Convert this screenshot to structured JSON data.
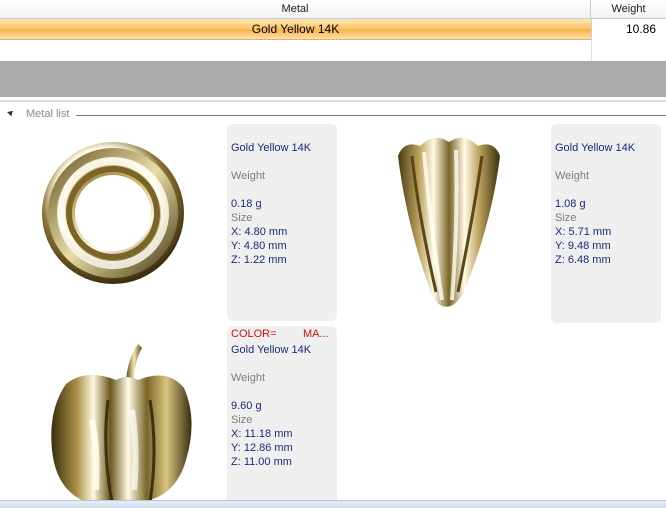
{
  "grid": {
    "columns": {
      "metal": "Metal",
      "weight": "Weight"
    },
    "rows": [
      {
        "metal": "Gold Yellow 14K",
        "weight": "10.86"
      }
    ]
  },
  "metal_list": {
    "title": "Metal list",
    "items": [
      {
        "name": "Gold Yellow 14K",
        "weight_label": "Weight",
        "weight": "0.18 g",
        "size_label": "Size",
        "x": "X: 4.80 mm",
        "y": "Y: 4.80 mm",
        "z": "Z: 1.22 mm",
        "shape": "ring"
      },
      {
        "name": "Gold Yellow 14K",
        "weight_label": "Weight",
        "weight": "1.08 g",
        "size_label": "Size",
        "x": "X: 5.71 mm",
        "y": "Y: 9.48 mm",
        "z": "Z: 6.48 mm",
        "shape": "cone"
      },
      {
        "color_label": "COLOR=",
        "color_value": "MA...",
        "name": "Gold Yellow 14K",
        "weight_label": "Weight",
        "weight": "9.60 g",
        "size_label": "Size",
        "x": "X: 11.18 mm",
        "y": "Y: 12.86 mm",
        "z": "Z: 11.00 mm",
        "shape": "pepper"
      }
    ]
  },
  "colors": {
    "selected_row": "#fbc86a",
    "info_text": "#1a2a7a",
    "label_text": "#7d7d7d",
    "color_tag": "#d01010",
    "gold": "#b8a060"
  }
}
